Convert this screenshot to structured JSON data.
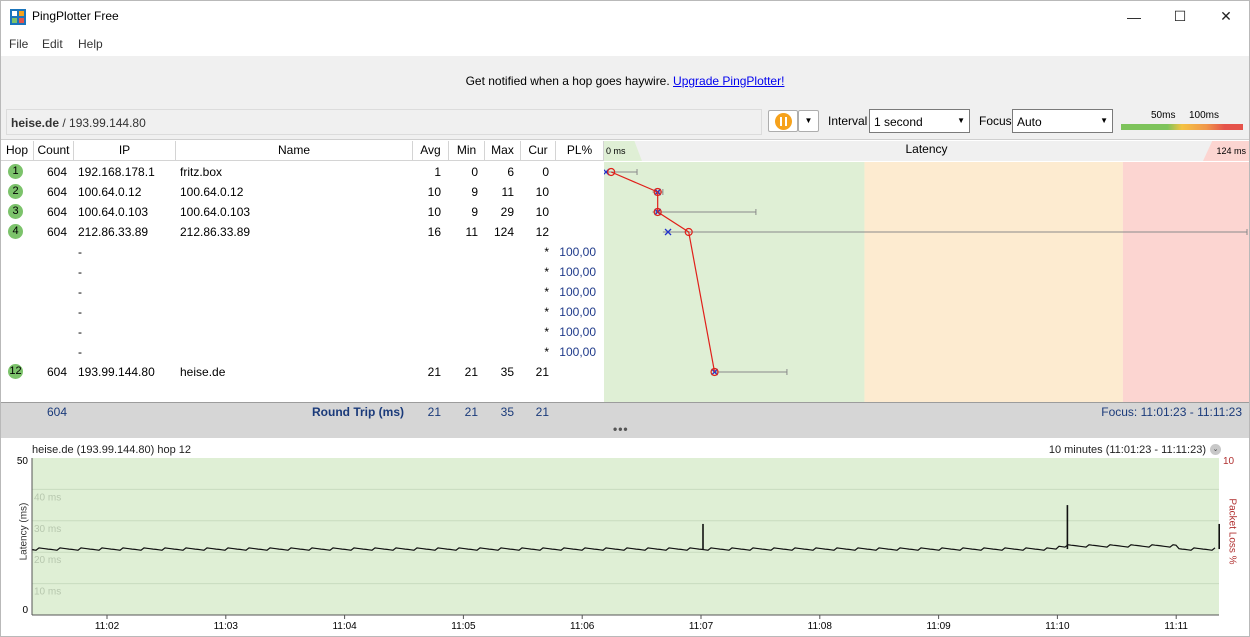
{
  "window": {
    "title": "PingPlotter Free",
    "minimize": "—",
    "maximize": "☐",
    "close": "✕"
  },
  "menu": [
    "File",
    "Edit",
    "Help"
  ],
  "banner": {
    "text": "Get notified when a hop goes haywire. ",
    "link": "Upgrade PingPlotter!"
  },
  "target": {
    "host": "heise.de",
    "ip": " / 193.99.144.80"
  },
  "toolbar": {
    "interval_label": "Interval",
    "interval_value": "1 second",
    "focus_label": "Focus",
    "focus_value": "Auto",
    "legend_50": "50ms",
    "legend_100": "100ms"
  },
  "columns": {
    "hop": "Hop",
    "count": "Count",
    "ip": "IP",
    "name": "Name",
    "avg": "Avg",
    "min": "Min",
    "max": "Max",
    "cur": "Cur",
    "pl": "PL%"
  },
  "latency_header": {
    "min": "0 ms",
    "title": "Latency",
    "max": "124 ms"
  },
  "hops": [
    {
      "hop": "1",
      "count": "604",
      "ip": "192.168.178.1",
      "name": "fritz.box",
      "avg": "1",
      "min": "0",
      "max": "6",
      "cur": "0",
      "pl": ""
    },
    {
      "hop": "2",
      "count": "604",
      "ip": "100.64.0.12",
      "name": "100.64.0.12",
      "avg": "10",
      "min": "9",
      "max": "11",
      "cur": "10",
      "pl": ""
    },
    {
      "hop": "3",
      "count": "604",
      "ip": "100.64.0.103",
      "name": "100.64.0.103",
      "avg": "10",
      "min": "9",
      "max": "29",
      "cur": "10",
      "pl": ""
    },
    {
      "hop": "4",
      "count": "604",
      "ip": "212.86.33.89",
      "name": "212.86.33.89",
      "avg": "16",
      "min": "11",
      "max": "124",
      "cur": "12",
      "pl": ""
    },
    {
      "hop": "",
      "count": "",
      "ip": "-",
      "name": "",
      "avg": "",
      "min": "",
      "max": "",
      "cur": "*",
      "pl": "100,00"
    },
    {
      "hop": "",
      "count": "",
      "ip": "-",
      "name": "",
      "avg": "",
      "min": "",
      "max": "",
      "cur": "*",
      "pl": "100,00"
    },
    {
      "hop": "",
      "count": "",
      "ip": "-",
      "name": "",
      "avg": "",
      "min": "",
      "max": "",
      "cur": "*",
      "pl": "100,00"
    },
    {
      "hop": "",
      "count": "",
      "ip": "-",
      "name": "",
      "avg": "",
      "min": "",
      "max": "",
      "cur": "*",
      "pl": "100,00"
    },
    {
      "hop": "",
      "count": "",
      "ip": "-",
      "name": "",
      "avg": "",
      "min": "",
      "max": "",
      "cur": "*",
      "pl": "100,00"
    },
    {
      "hop": "",
      "count": "",
      "ip": "-",
      "name": "",
      "avg": "",
      "min": "",
      "max": "",
      "cur": "*",
      "pl": "100,00"
    },
    {
      "hop": "12",
      "count": "604",
      "ip": "193.99.144.80",
      "name": "heise.de",
      "avg": "21",
      "min": "21",
      "max": "35",
      "cur": "21",
      "pl": ""
    }
  ],
  "summary": {
    "count": "604",
    "label": "Round Trip (ms)",
    "avg": "21",
    "min": "21",
    "max": "35",
    "cur": "21",
    "focus": "Focus: 11:01:23 - 11:11:23"
  },
  "splitter": "•••",
  "graph": {
    "title": "heise.de (193.99.144.80) hop 12",
    "range": "10 minutes (11:01:23 - 11:11:23)",
    "range_btn": "⌄",
    "ylabel": "Latency (ms)",
    "y2label": "Packet Loss %",
    "y_top": "50",
    "y_bottom": "0",
    "y2_top": "10",
    "gridlines": [
      "40 ms",
      "30 ms",
      "20 ms",
      "10 ms"
    ],
    "x_ticks": [
      "11:02",
      "11:03",
      "11:04",
      "11:05",
      "11:06",
      "11:07",
      "11:08",
      "11:09",
      "11:10",
      "11:11"
    ]
  },
  "colors": {
    "good": "#dfefd5",
    "warn": "#fdebd0",
    "bad": "#fcd5d1",
    "hop_badge": "#7cc36b",
    "pause": "#f6a21c"
  },
  "chart_data": {
    "type": "line",
    "ylabel": "Latency (ms)",
    "ylim": [
      0,
      50
    ],
    "x": [
      "11:02",
      "11:03",
      "11:04",
      "11:05",
      "11:06",
      "11:07",
      "11:08",
      "11:09",
      "11:10",
      "11:11"
    ],
    "series": [
      {
        "values": [
          21,
          21,
          21,
          21,
          21,
          21,
          21,
          21,
          22,
          21
        ]
      }
    ],
    "spikes": [
      {
        "time": "11:07",
        "value": 29
      },
      {
        "time": "11:10",
        "value": 35
      },
      {
        "time": "11:11",
        "value": 29
      }
    ],
    "latency_plot": {
      "xlim": [
        0,
        124
      ],
      "hop_avg": [
        1,
        10,
        10,
        16,
        21
      ],
      "hop_min": [
        0,
        9,
        9,
        11,
        21
      ],
      "hop_max": [
        6,
        11,
        29,
        124,
        35
      ],
      "hop_cur": [
        0,
        10,
        10,
        12,
        21
      ]
    }
  }
}
